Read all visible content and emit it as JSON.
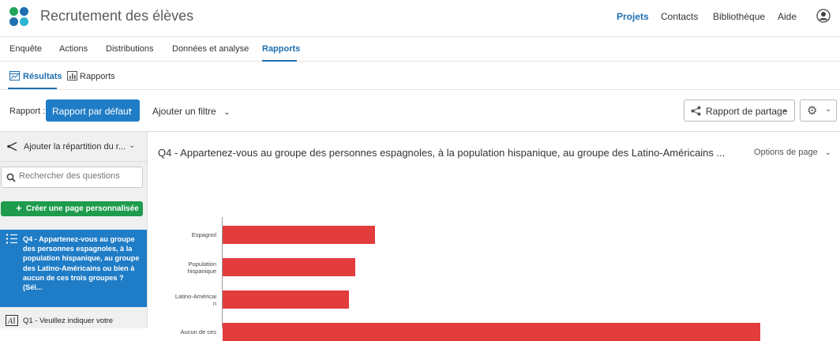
{
  "app": {
    "project_title": "Recrutement des élèves",
    "logo_colors": [
      "#21a55a",
      "#1f6fb0",
      "#1f6fb0",
      "#2cb5d1"
    ]
  },
  "top_nav": {
    "items": [
      {
        "label": "Projets",
        "active": true
      },
      {
        "label": "Contacts",
        "active": false
      },
      {
        "label": "Bibliothèque",
        "active": false
      },
      {
        "label": "Aide",
        "active": false
      }
    ],
    "user_icon": "user-circle-icon"
  },
  "tabs": [
    {
      "label": "Enquête",
      "active": false
    },
    {
      "label": "Actions",
      "active": false
    },
    {
      "label": "Distributions",
      "active": false
    },
    {
      "label": "Données et analyse",
      "active": false
    },
    {
      "label": "Rapports",
      "active": true
    }
  ],
  "subtabs": [
    {
      "label": "Résultats",
      "icon": "results-icon",
      "active": true
    },
    {
      "label": "Rapports",
      "icon": "bar-chart-icon",
      "active": false
    }
  ],
  "toolbar": {
    "report_label": "Rapport :",
    "report_select": "Rapport par défaut",
    "add_filter": "Ajouter un filtre",
    "share_button": "Rapport de partage",
    "settings_icon": "gear-icon"
  },
  "sidebar": {
    "breakdown_label": "Ajouter la répartition du r...",
    "search_placeholder": "Rechercher des questions",
    "create_page_button": "Créer une page personnalisée",
    "questions": [
      {
        "text": "Q4 - Appartenez-vous au groupe des personnes espagnoles, à la population hispanique, au groupe des Latino-Américains ou bien à aucun de ces trois groupes ? (Sél...",
        "active": true
      },
      {
        "text": "Q1 - Veuillez indiquer votre",
        "active": false
      }
    ]
  },
  "main": {
    "page_title": "Q4 - Appartenez-vous au groupe des personnes espagnoles, à la population hispanique, au groupe des Latino-Américains ...",
    "page_options": "Options de page"
  },
  "chart_data": {
    "type": "bar",
    "orientation": "horizontal",
    "categories": [
      "Espagnol",
      "Population hispanique",
      "Latino-Américain",
      "Aucun de ces"
    ],
    "values": [
      23,
      20,
      19,
      81
    ],
    "color": "#e23c3c",
    "xlim": [
      0,
      81
    ],
    "grid": false
  },
  "colors": {
    "accent": "#1f7cc6",
    "success": "#1e9b4d",
    "bar": "#e23c3c"
  }
}
